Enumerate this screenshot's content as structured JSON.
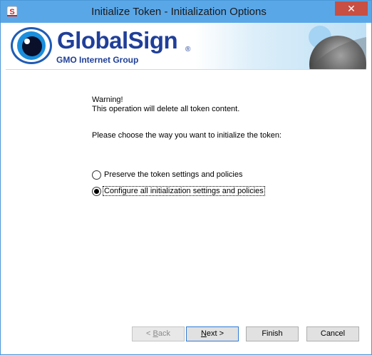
{
  "window": {
    "title": "Initialize Token - Initialization Options",
    "close_glyph": "✕",
    "app_icon": "safenet-s-icon",
    "titlebar_color": "#5aa7e8",
    "close_color": "#c74f43"
  },
  "banner": {
    "brand_name": "GlobalSign",
    "brand_registered": "®",
    "brand_sub_prefix": "GMO",
    "brand_sub_rest": " Internet Group",
    "brand_color": "#1f3f99"
  },
  "body": {
    "warning_title": "Warning!",
    "warning_text": "This operation will delete all token content.",
    "prompt": "Please choose the way you want to initialize the token:",
    "options": [
      {
        "label": "Preserve the token settings and policies",
        "checked": false
      },
      {
        "label": "Configure all initialization settings and policies",
        "checked": true
      }
    ]
  },
  "buttons": {
    "back": "< Back",
    "next": "Next >",
    "finish": "Finish",
    "cancel": "Cancel"
  }
}
